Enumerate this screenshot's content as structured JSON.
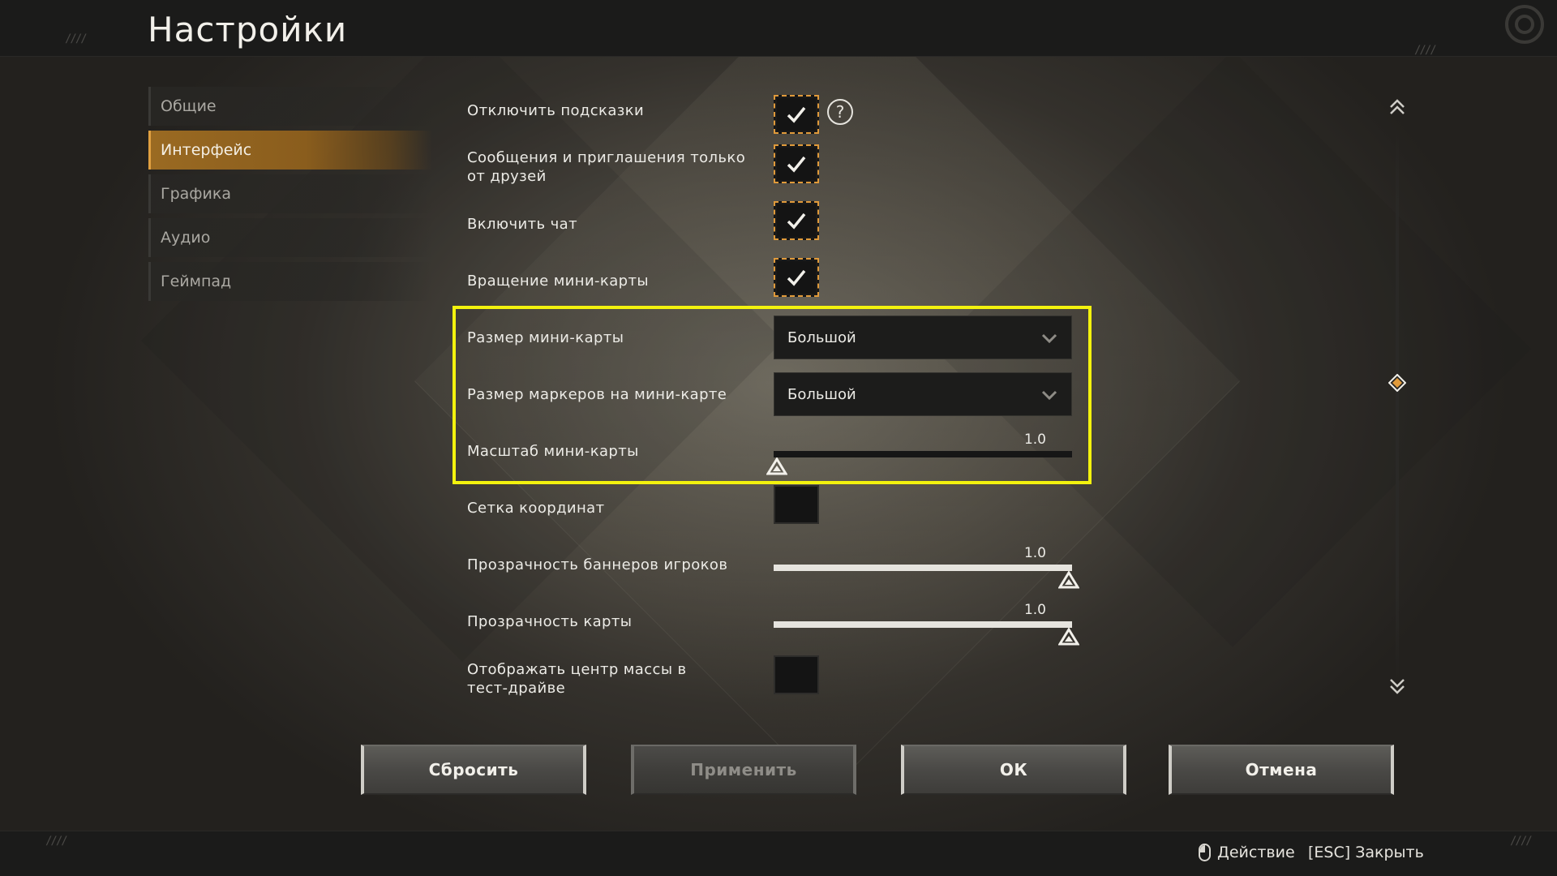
{
  "header": {
    "title": "Настройки"
  },
  "sidebar": {
    "items": [
      {
        "label": "Общие",
        "active": false
      },
      {
        "label": "Интерфейс",
        "active": true
      },
      {
        "label": "Графика",
        "active": false
      },
      {
        "label": "Аудио",
        "active": false
      },
      {
        "label": "Геймпад",
        "active": false
      }
    ]
  },
  "settings": {
    "disable_hints": {
      "label": "Отключить подсказки",
      "checked": true,
      "help_glyph": "?"
    },
    "friends_only": {
      "label": "Сообщения и приглашения только от друзей",
      "checked": true
    },
    "enable_chat": {
      "label": "Включить чат",
      "checked": true
    },
    "minimap_rotation": {
      "label": "Вращение мини-карты",
      "checked": true
    },
    "minimap_size": {
      "label": "Размер мини-карты",
      "value": "Большой"
    },
    "minimap_marker_size": {
      "label": "Размер маркеров на мини-карте",
      "value": "Большой"
    },
    "minimap_scale": {
      "label": "Масштаб мини-карты",
      "value_text": "1.0",
      "fill_fraction": 0.0
    },
    "coordinate_grid": {
      "label": "Сетка координат",
      "checked": false
    },
    "player_banner_opacity": {
      "label": "Прозрачность баннеров игроков",
      "value_text": "1.0",
      "fill_fraction": 1.0
    },
    "map_opacity": {
      "label": "Прозрачность карты",
      "value_text": "1.0",
      "fill_fraction": 1.0
    },
    "center_of_mass": {
      "label": "Отображать центр массы в тест-драйве",
      "checked": false
    }
  },
  "buttons": {
    "reset": "Сбросить",
    "apply": "Применить",
    "ok": "ОК",
    "cancel": "Отмена"
  },
  "footer": {
    "action_hint": "Действие",
    "close_hint": "[ESC] Закрыть"
  },
  "colors": {
    "accent": "#e09a3a",
    "highlight": "#f3f20e",
    "active_tab": "#9a6a22"
  },
  "icons": {
    "check": "check-icon",
    "help": "question-circle-icon",
    "chevron": "chevron-down-icon",
    "slider_thumb": "triangle-up-icon",
    "scroll_up": "double-chevron-up-icon",
    "scroll_down": "double-chevron-down-icon",
    "scroll_thumb": "diamond-icon",
    "mouse": "mouse-icon"
  }
}
